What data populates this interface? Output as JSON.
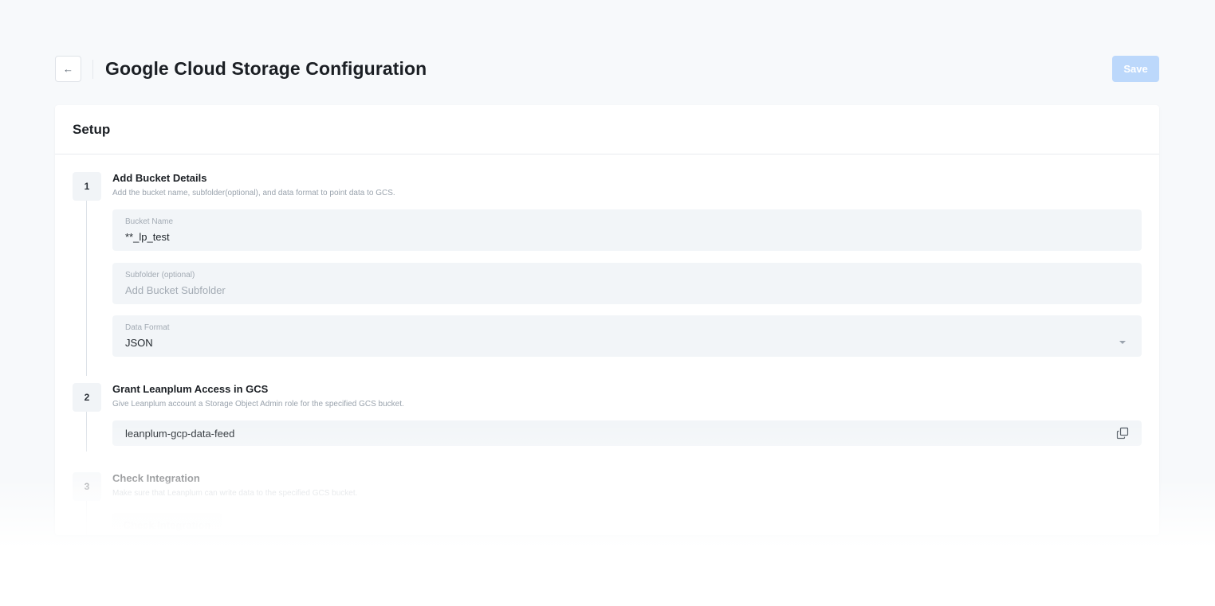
{
  "header": {
    "back_icon": "arrow-left-icon",
    "back_glyph": "←",
    "title": "Google Cloud Storage Configuration",
    "save_label": "Save"
  },
  "card": {
    "title": "Setup",
    "steps": [
      {
        "number": "1",
        "title": "Add Bucket Details",
        "description": "Add the bucket name, subfolder(optional), and data format to point data to GCS.",
        "fields": {
          "bucket_name": {
            "label": "Bucket Name",
            "value": "**_lp_test"
          },
          "subfolder": {
            "label": "Subfolder (optional)",
            "placeholder": "Add Bucket Subfolder"
          },
          "data_format": {
            "label": "Data Format",
            "value": "JSON",
            "icon": "chevron-down-icon"
          }
        }
      },
      {
        "number": "2",
        "title": "Grant Leanplum Access in GCS",
        "description": "Give Leanplum account a Storage Object Admin role for the specified GCS bucket.",
        "account": "leanplum-gcp-data-feed",
        "copy_icon": "copy-icon"
      },
      {
        "number": "3",
        "title": "Check Integration",
        "description": "Make sure that Leanplum can write data to the specified GCS bucket.",
        "button_label": "Check Integration"
      }
    ]
  },
  "colors": {
    "background": "#f7f9fb",
    "save_button": "#bcd8fb",
    "field_background": "#f2f5f8",
    "text_primary": "#1b1f24",
    "text_muted": "#9aa3ad"
  }
}
